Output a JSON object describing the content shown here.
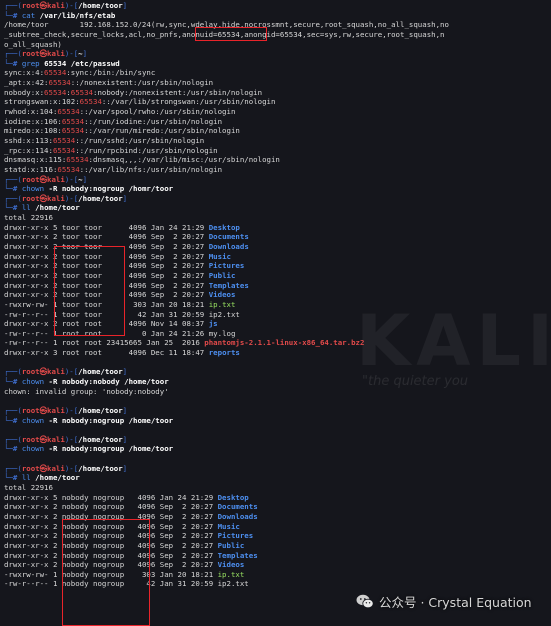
{
  "prompt": {
    "box_top": "┌──(",
    "box_bottom": "└─",
    "user_host": "root㉿kali",
    "sep": ")-[",
    "close": "]",
    "hash": "# ",
    "path1": "/home/toor",
    "path2": "~"
  },
  "blocks": [
    {
      "type": "prompt",
      "path": "/home/toor",
      "cmd": "cat",
      "args": " /var/lib/nfs/etab"
    },
    {
      "type": "plain",
      "text": "/home/toor       192.168.152.0/24(rw,sync,wdelay,hide,nocrossmnt,secure,root_squash,no_all_squash,no"
    },
    {
      "type": "plain",
      "text": "_subtree_check,secure_locks,acl,no_pnfs,anonuid=65534,anongid=65534,sec=sys,rw,secure,root_squash,n"
    },
    {
      "type": "plain",
      "text": "o_all_squash)"
    },
    {
      "type": "prompt",
      "path": "~",
      "cmd": "grep",
      "args": " 65534 /etc/passwd"
    },
    {
      "type": "passwd",
      "pre": "sync:x:4:",
      "red": "65534",
      "post": ":sync:/bin:/bin/sync"
    },
    {
      "type": "passwd",
      "pre": "_apt:x:42:",
      "red": "65534",
      "post": "::/nonexistent:/usr/sbin/nologin"
    },
    {
      "type": "passwd",
      "pre": "nobody:x:",
      "red": "65534",
      "mid": ":",
      "red2": "65534",
      "post": ":nobody:/nonexistent:/usr/sbin/nologin"
    },
    {
      "type": "passwd",
      "pre": "strongswan:x:102:",
      "red": "65534",
      "post": "::/var/lib/strongswan:/usr/sbin/nologin"
    },
    {
      "type": "passwd",
      "pre": "rwhod:x:104:",
      "red": "65534",
      "post": "::/var/spool/rwho:/usr/sbin/nologin"
    },
    {
      "type": "passwd",
      "pre": "iodine:x:106:",
      "red": "65534",
      "post": "::/run/iodine:/usr/sbin/nologin"
    },
    {
      "type": "passwd",
      "pre": "miredo:x:108:",
      "red": "65534",
      "post": "::/var/run/miredo:/usr/sbin/nologin"
    },
    {
      "type": "passwd",
      "pre": "sshd:x:113:",
      "red": "65534",
      "post": "::/run/sshd:/usr/sbin/nologin"
    },
    {
      "type": "passwd",
      "pre": "_rpc:x:114:",
      "red": "65534",
      "post": "::/run/rpcbind:/usr/sbin/nologin"
    },
    {
      "type": "passwd",
      "pre": "dnsmasq:x:115:",
      "red": "65534",
      "post": ":dnsmasq,,,:/var/lib/misc:/usr/sbin/nologin"
    },
    {
      "type": "passwd",
      "pre": "statd:x:116:",
      "red": "65534",
      "post": "::/var/lib/nfs:/usr/sbin/nologin"
    },
    {
      "type": "prompt",
      "path": "~",
      "cmd": "chown",
      "args": " -R nobody:nogroup /homr/toor"
    },
    {
      "type": "prompt",
      "path": "/home/toor",
      "cmd": "ll",
      "args": " /home/toor"
    },
    {
      "type": "plain",
      "text": "total 22916"
    },
    {
      "type": "ls",
      "perm": "drwxr-xr-x 5 ",
      "owner": "toor toor   ",
      "meta": "   4096 Jan 24 21:29 ",
      "name": "Desktop",
      "kind": "dir"
    },
    {
      "type": "ls",
      "perm": "drwxr-xr-x 2 ",
      "owner": "toor toor   ",
      "meta": "   4096 Sep  2 20:27 ",
      "name": "Documents",
      "kind": "dir"
    },
    {
      "type": "ls",
      "perm": "drwxr-xr-x 2 ",
      "owner": "toor toor   ",
      "meta": "   4096 Sep  2 20:27 ",
      "name": "Downloads",
      "kind": "dir"
    },
    {
      "type": "ls",
      "perm": "drwxr-xr-x 2 ",
      "owner": "toor toor   ",
      "meta": "   4096 Sep  2 20:27 ",
      "name": "Music",
      "kind": "dir"
    },
    {
      "type": "ls",
      "perm": "drwxr-xr-x 2 ",
      "owner": "toor toor   ",
      "meta": "   4096 Sep  2 20:27 ",
      "name": "Pictures",
      "kind": "dir"
    },
    {
      "type": "ls",
      "perm": "drwxr-xr-x 2 ",
      "owner": "toor toor   ",
      "meta": "   4096 Sep  2 20:27 ",
      "name": "Public",
      "kind": "dir"
    },
    {
      "type": "ls",
      "perm": "drwxr-xr-x 2 ",
      "owner": "toor toor   ",
      "meta": "   4096 Sep  2 20:27 ",
      "name": "Templates",
      "kind": "dir"
    },
    {
      "type": "ls",
      "perm": "drwxr-xr-x 2 ",
      "owner": "toor toor   ",
      "meta": "   4096 Sep  2 20:27 ",
      "name": "Videos",
      "kind": "dir"
    },
    {
      "type": "ls",
      "perm": "-rwxrw-rw- 1 ",
      "owner": "toor toor   ",
      "meta": "    303 Jan 20 18:21 ",
      "name": "ip.txt",
      "kind": "exe"
    },
    {
      "type": "ls",
      "perm": "-rw-r--r-- 1 ",
      "owner": "toor toor   ",
      "meta": "     42 Jan 31 20:59 ",
      "name": "ip2.txt",
      "kind": "file"
    },
    {
      "type": "ls",
      "perm": "drwxr-xr-x 2 ",
      "owner": "root root   ",
      "meta": "   4096 Nov 14 08:37 ",
      "name": "js",
      "kind": "dir"
    },
    {
      "type": "ls",
      "perm": "-rw-r--r-- 1 ",
      "owner": "root root   ",
      "meta": "      0 Jan 24 21:26 ",
      "name": "my.log",
      "kind": "file"
    },
    {
      "type": "ls",
      "perm": "-rw-r--r-- 1 ",
      "owner": "root root ",
      "meta": "23415665 Jan 25  2016 ",
      "name": "phantomjs-2.1.1-linux-x86_64.tar.bz2",
      "kind": "arc"
    },
    {
      "type": "ls",
      "perm": "drwxr-xr-x 3 ",
      "owner": "root root   ",
      "meta": "   4096 Dec 11 18:47 ",
      "name": "reports",
      "kind": "dir"
    },
    {
      "type": "blank"
    },
    {
      "type": "prompt",
      "path": "/home/toor",
      "cmd": "chown",
      "args": " -R nobody:nobody /home/toor"
    },
    {
      "type": "plain",
      "text": "chown: invalid group: 'nobody:nobody'"
    },
    {
      "type": "blank"
    },
    {
      "type": "prompt",
      "path": "/home/toor",
      "cmd": "chown",
      "args": " -R nobody:nogroup /home/toor"
    },
    {
      "type": "blank"
    },
    {
      "type": "prompt",
      "path": "/home/toor",
      "cmd": "chown",
      "args": " -R nobody:nogroup /home/toor"
    },
    {
      "type": "blank"
    },
    {
      "type": "prompt",
      "path": "/home/toor",
      "cmd": "ll",
      "args": " /home/toor"
    },
    {
      "type": "plain",
      "text": "total 22916"
    },
    {
      "type": "ls",
      "perm": "drwxr-xr-x 5 ",
      "owner": "nobody nogroup",
      "meta": "   4096 Jan 24 21:29 ",
      "name": "Desktop",
      "kind": "dir"
    },
    {
      "type": "ls",
      "perm": "drwxr-xr-x 2 ",
      "owner": "nobody nogroup",
      "meta": "   4096 Sep  2 20:27 ",
      "name": "Documents",
      "kind": "dir"
    },
    {
      "type": "ls",
      "perm": "drwxr-xr-x 2 ",
      "owner": "nobody nogroup",
      "meta": "   4096 Sep  2 20:27 ",
      "name": "Downloads",
      "kind": "dir"
    },
    {
      "type": "ls",
      "perm": "drwxr-xr-x 2 ",
      "owner": "nobody nogroup",
      "meta": "   4096 Sep  2 20:27 ",
      "name": "Music",
      "kind": "dir"
    },
    {
      "type": "ls",
      "perm": "drwxr-xr-x 2 ",
      "owner": "nobody nogroup",
      "meta": "   4096 Sep  2 20:27 ",
      "name": "Pictures",
      "kind": "dir"
    },
    {
      "type": "ls",
      "perm": "drwxr-xr-x 2 ",
      "owner": "nobody nogroup",
      "meta": "   4096 Sep  2 20:27 ",
      "name": "Public",
      "kind": "dir"
    },
    {
      "type": "ls",
      "perm": "drwxr-xr-x 2 ",
      "owner": "nobody nogroup",
      "meta": "   4096 Sep  2 20:27 ",
      "name": "Templates",
      "kind": "dir"
    },
    {
      "type": "ls",
      "perm": "drwxr-xr-x 2 ",
      "owner": "nobody nogroup",
      "meta": "   4096 Sep  2 20:27 ",
      "name": "Videos",
      "kind": "dir"
    },
    {
      "type": "ls",
      "perm": "-rwxrw-rw- 1 ",
      "owner": "nobody nogroup",
      "meta": "    303 Jan 20 18:21 ",
      "name": "ip.txt",
      "kind": "exe"
    },
    {
      "type": "ls",
      "perm": "-rw-r--r-- 1 ",
      "owner": "nobody nogroup",
      "meta": "     42 Jan 31 20:59 ",
      "name": "ip2.txt",
      "kind": "file"
    }
  ],
  "watermark": {
    "brand": "KALI",
    "tagline": "\"the quieter you",
    "wechat_icon": "wechat-icon",
    "wechat_text": "公众号 · Crystal Equation"
  },
  "colors": {
    "highlight_box": "#e8242a",
    "prompt_user": "#e24a4a",
    "prompt_frame": "#3f6fd1",
    "directory": "#4d8ff0"
  }
}
